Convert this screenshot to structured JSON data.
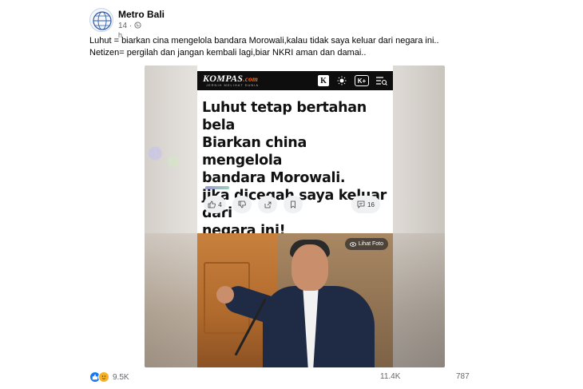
{
  "post": {
    "author": "Metro Bali",
    "time": "14",
    "time_suffix": "h",
    "caption_line1": "Luhut = biarkan cina mengelola bandara Morowali,kalau tidak saya keluar dari negara ini..",
    "caption_line2": "Netizen= pergilah dan jangan kembali lagi,biar NKRI aman dan damai.."
  },
  "article": {
    "brand": "KOMPAS",
    "brand_suffix": ".com",
    "tagline": "JERNIH MELIHAT DUNIA",
    "icons": [
      "k-icon",
      "sun-icon",
      "k-plus-icon",
      "search-menu-icon"
    ],
    "kplus_label": "K+",
    "k_label": "K",
    "headline_lines": [
      "Luhut tetap bertahan bela",
      "Biarkan china mengelola",
      "bandara Morowali.",
      "jika dicegah saya keluar dari",
      "negara ini!"
    ],
    "like_count": "4",
    "comment_count": "16",
    "photo_button": "Lihat Foto"
  },
  "footer": {
    "reactions": [
      "like-icon",
      "care-icon"
    ],
    "reaction_count": "9.5K",
    "comments_count": "11.4K",
    "shares_count": "787"
  }
}
